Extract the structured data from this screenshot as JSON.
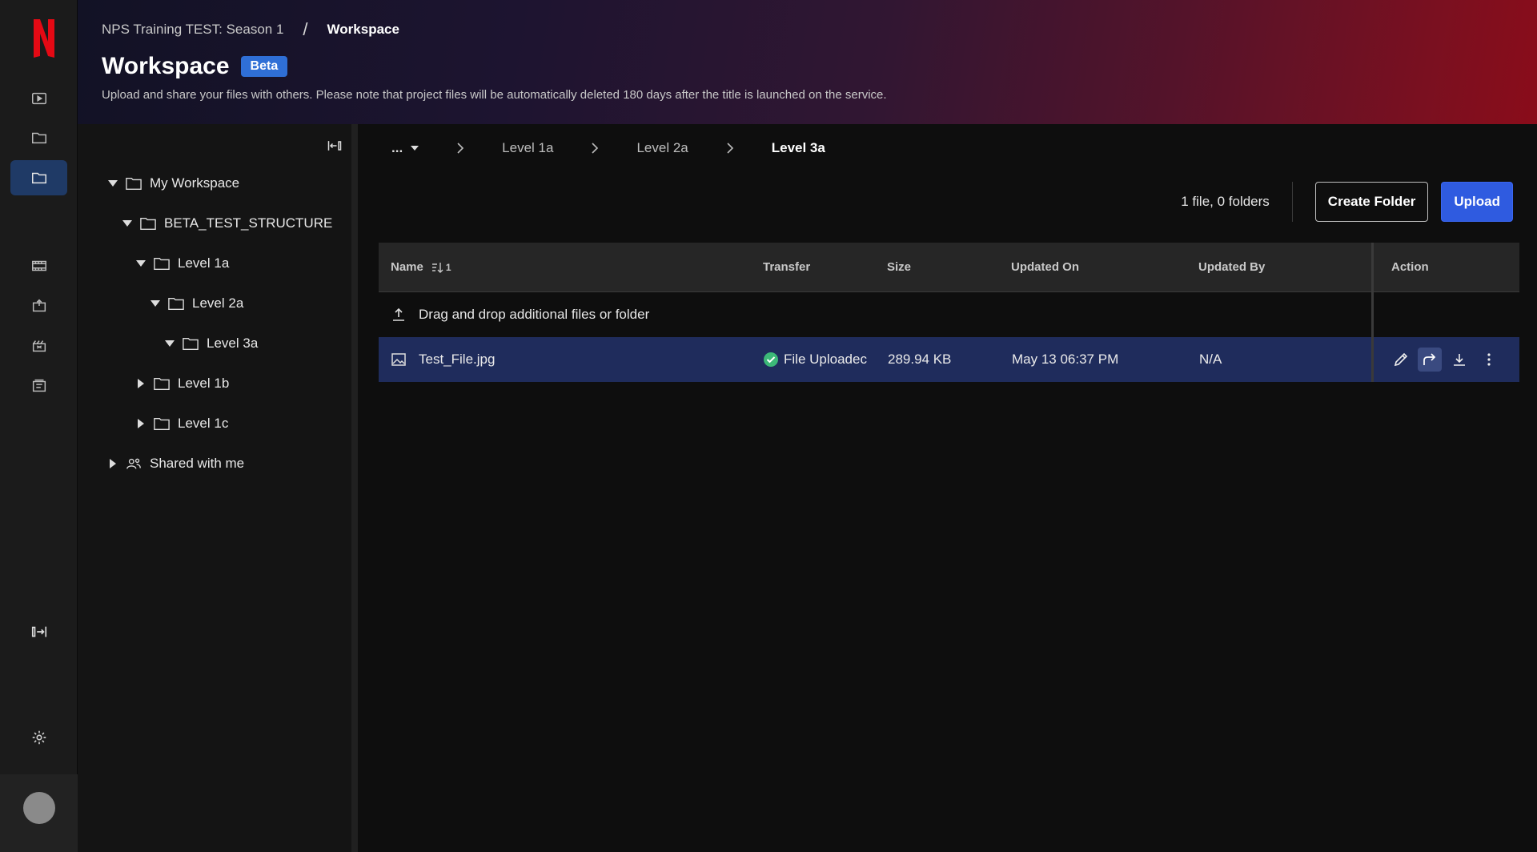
{
  "header": {
    "breadcrumb_project": "NPS Training TEST: Season 1",
    "breadcrumb_separator": "/",
    "breadcrumb_current": "Workspace",
    "title": "Workspace",
    "badge": "Beta",
    "subtitle": "Upload and share your files with others. Please note that project files will be automatically deleted 180 days after the title is launched on the service."
  },
  "tree": {
    "items": [
      {
        "label": "My Workspace"
      },
      {
        "label": "BETA_TEST_STRUCTURE"
      },
      {
        "label": "Level 1a"
      },
      {
        "label": "Level 2a"
      },
      {
        "label": "Level 3a"
      },
      {
        "label": "Level 1b"
      },
      {
        "label": "Level 1c"
      },
      {
        "label": "Shared with me"
      }
    ]
  },
  "path": {
    "ellipsis": "...",
    "levels": [
      "Level 1a",
      "Level 2a",
      "Level 3a"
    ]
  },
  "toolbar": {
    "count": "1 file, 0 folders",
    "create_folder": "Create Folder",
    "upload": "Upload"
  },
  "table": {
    "headers": {
      "name": "Name",
      "sort": "1",
      "transfer": "Transfer",
      "size": "Size",
      "updated_on": "Updated On",
      "updated_by": "Updated By",
      "action": "Action"
    },
    "drop_text": "Drag and drop additional files or folder",
    "rows": [
      {
        "name": "Test_File.jpg",
        "transfer": "File Uploadec",
        "size": "289.94 KB",
        "updated_on": "May 13 06:37 PM",
        "updated_by": "N/A"
      }
    ]
  },
  "colors": {
    "accent": "#2f5be0",
    "badge": "#2f6fd6",
    "selected_row": "#1f2c5c",
    "success": "#3cb878",
    "brand_red": "#e50914"
  }
}
